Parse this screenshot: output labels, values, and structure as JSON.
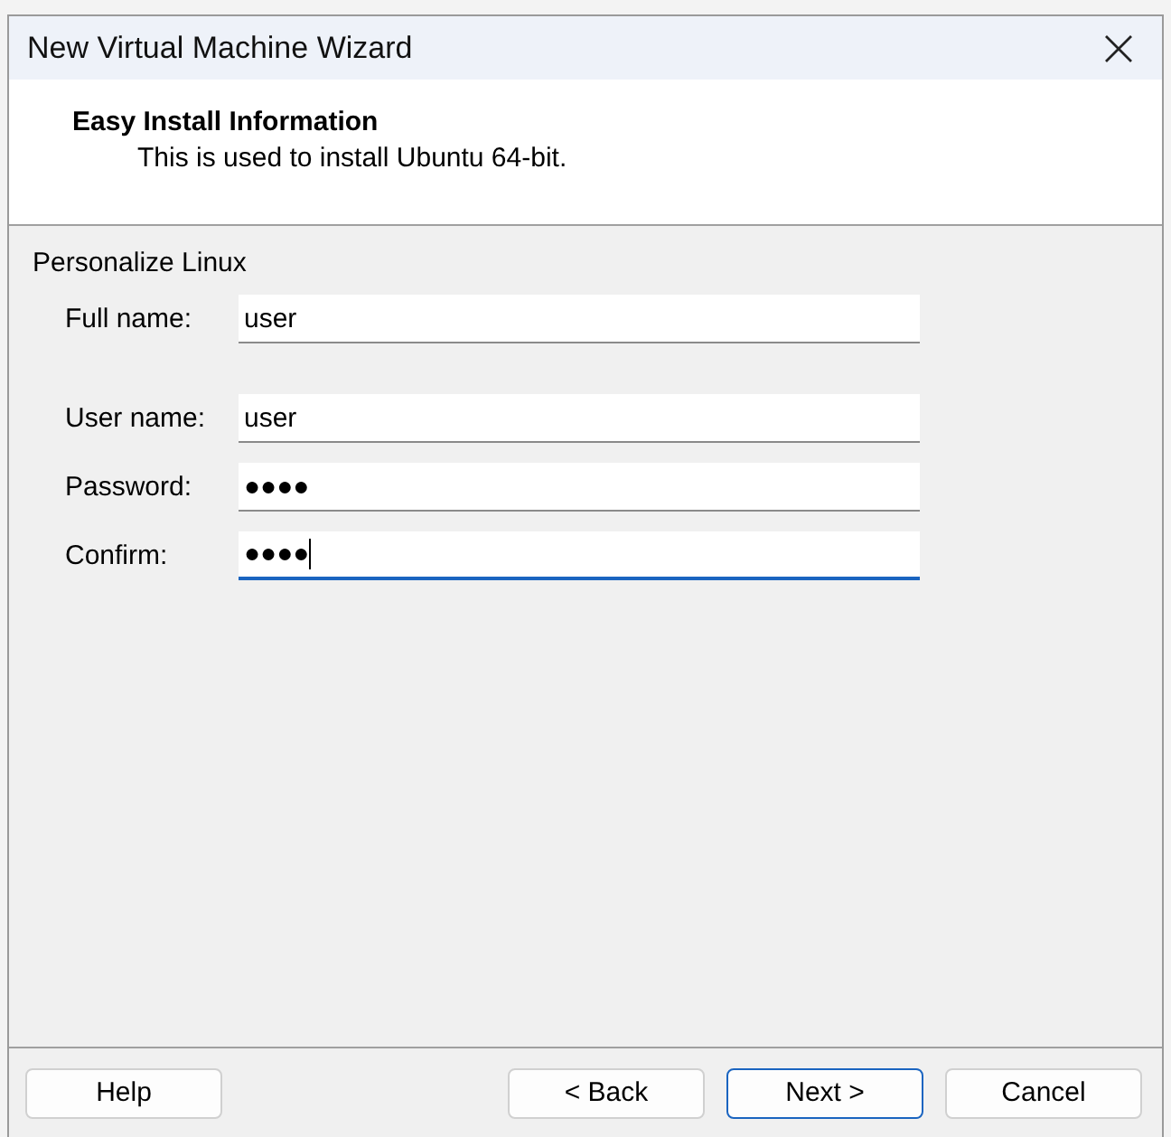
{
  "window": {
    "title": "New Virtual Machine Wizard"
  },
  "header": {
    "title": "Easy Install Information",
    "subtitle": "This is used to install Ubuntu 64-bit."
  },
  "group": {
    "label": "Personalize Linux"
  },
  "fields": [
    {
      "label": "Full name:",
      "value": "user",
      "focused": false
    },
    {
      "label": "User name:",
      "value": "user",
      "focused": false
    },
    {
      "label": "Password:",
      "value": "●●●●",
      "focused": false
    },
    {
      "label": "Confirm:",
      "value": "●●●●",
      "focused": true
    }
  ],
  "buttons": [
    {
      "label": "Help",
      "default": false,
      "kind": "left"
    },
    {
      "label": "< Back",
      "default": false,
      "kind": "right"
    },
    {
      "label": "Next >",
      "default": true,
      "kind": "right"
    },
    {
      "label": "Cancel",
      "default": false,
      "kind": "right"
    }
  ]
}
